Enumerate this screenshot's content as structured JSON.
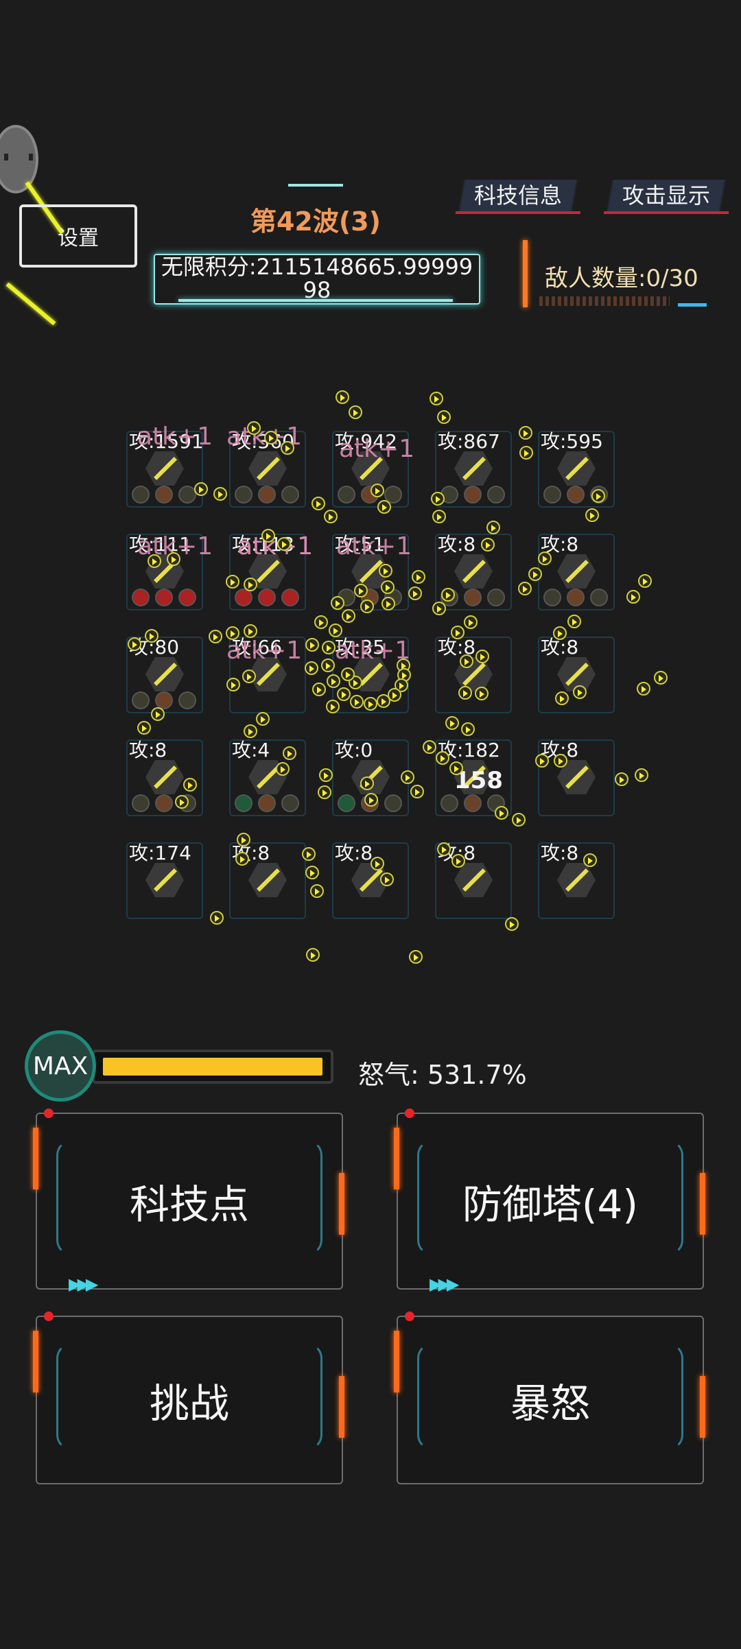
{
  "header": {
    "settings_label": "设置",
    "wave": "第42波(3)",
    "score_line1": "无限积分:2115148665.99999",
    "score_line2": "98",
    "tech_info_label": "科技信息",
    "attack_display_label": "攻击显示",
    "enemy_count": "敌人数量:0/30"
  },
  "grid": {
    "rows": [
      [
        "攻:1591",
        "攻:360",
        "攻:942",
        "攻:867",
        "攻:595"
      ],
      [
        "攻:111",
        "攻:113",
        "攻:51",
        "攻:8",
        "攻:8"
      ],
      [
        "攻:80",
        "攻:66",
        "攻:35",
        "攻:8",
        "攻:8"
      ],
      [
        "攻:8",
        "攻:4",
        "攻:0",
        "攻:182",
        "攻:8"
      ],
      [
        "攻:174",
        "攻:8",
        "攻:8",
        "攻:8",
        "攻:8"
      ]
    ],
    "floating": [
      "atk+1",
      "atk+1",
      "atk+1",
      "atk+1",
      "atk+1",
      "atk+1",
      "atk+1",
      "atk+1",
      "atk+1"
    ],
    "damage_number": "158"
  },
  "rage": {
    "badge": "MAX",
    "label": "怒气: 531.7%",
    "fill_fraction": 1.0
  },
  "actions": {
    "tech_points": "科技点",
    "towers": "防御塔(4)",
    "challenge": "挑战",
    "fury": "暴怒"
  },
  "colors": {
    "wave": "#f19a5a",
    "accent_cyan": "#9fe7e7",
    "rage_fill": "#f9c324",
    "orange": "#ff6a1a"
  }
}
